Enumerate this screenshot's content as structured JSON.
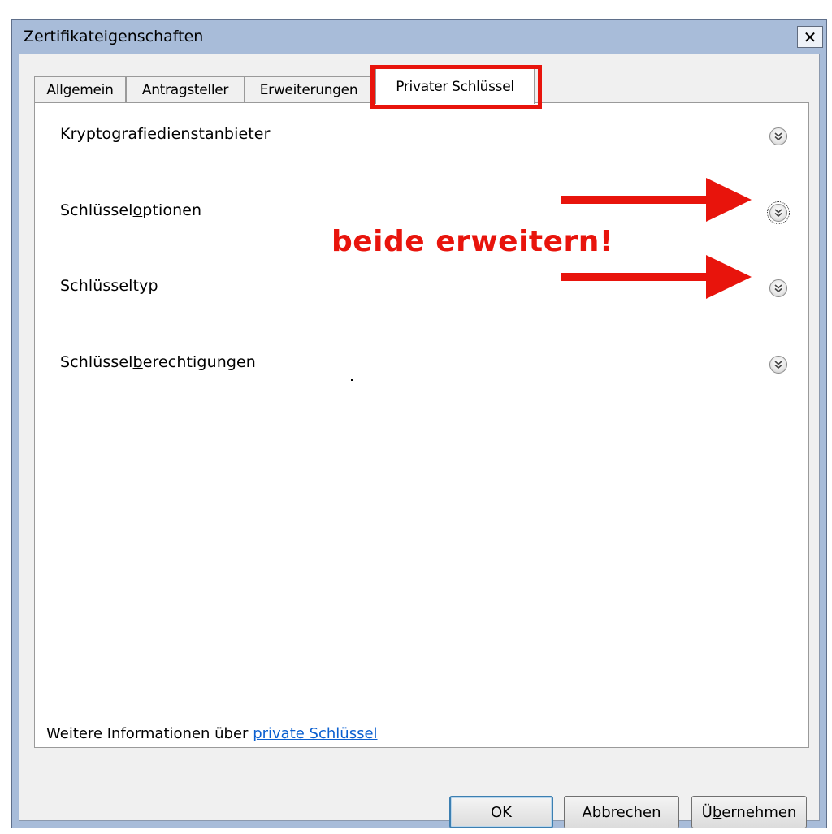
{
  "window": {
    "title": "Zertifikateigenschaften",
    "close_glyph": "✕"
  },
  "tabs": [
    {
      "label": "Allgemein",
      "active": false
    },
    {
      "label": "Antragsteller",
      "active": false
    },
    {
      "label": "Erweiterungen",
      "active": false
    },
    {
      "label": "Privater Schlüssel",
      "active": true
    }
  ],
  "sections": [
    {
      "pre": "",
      "accel": "K",
      "post": "ryptografiedienstanbieter",
      "expander_icon": "chevron-double-down-icon"
    },
    {
      "pre": "Schlüssel",
      "accel": "o",
      "post": "ptionen",
      "expander_icon": "chevron-double-down-icon"
    },
    {
      "pre": "Schlüssel",
      "accel": "t",
      "post": "yp",
      "expander_icon": "chevron-double-down-icon"
    },
    {
      "pre": "Schlüssel",
      "accel": "b",
      "post": "erechtigungen",
      "expander_icon": "chevron-double-down-icon"
    }
  ],
  "annotation": {
    "text": "beide erweitern!",
    "color": "#e8140c"
  },
  "footer": {
    "text": "Weitere Informationen über ",
    "link": "private Schlüssel"
  },
  "buttons": {
    "ok": "OK",
    "cancel": "Abbrechen",
    "apply_pre": "Ü",
    "apply_accel": "b",
    "apply_post": "ernehmen"
  }
}
